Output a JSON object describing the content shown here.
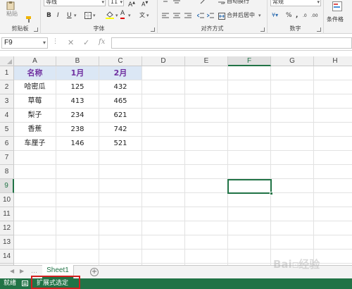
{
  "ribbon": {
    "clipboard": {
      "paste_label": "粘贴",
      "group_label": "剪贴板"
    },
    "font": {
      "font_name": "等线",
      "font_size": "11",
      "bold": "B",
      "italic": "I",
      "underline": "U",
      "font_color_glyph": "A",
      "phonetic_glyph": "文",
      "group_label": "字体"
    },
    "alignment": {
      "wrap_text": "自动换行",
      "merge_center": "合并后居中",
      "group_label": "对齐方式"
    },
    "number": {
      "format": "常规",
      "group_label": "数字"
    },
    "styles": {
      "conditional_format": "条件格"
    }
  },
  "formula_bar": {
    "name_box": "F9",
    "formula": ""
  },
  "grid": {
    "columns": [
      "A",
      "B",
      "C",
      "D",
      "E",
      "F",
      "G",
      "H"
    ],
    "selected_column": "F",
    "rows": [
      "1",
      "2",
      "3",
      "4",
      "5",
      "6",
      "7",
      "8",
      "9",
      "10",
      "11",
      "12",
      "13",
      "14"
    ],
    "selected_row": "9",
    "table": {
      "headers": [
        "名称",
        "1月",
        "2月"
      ],
      "rows": [
        [
          "哈密瓜",
          "125",
          "432"
        ],
        [
          "草莓",
          "413",
          "465"
        ],
        [
          "梨子",
          "234",
          "621"
        ],
        [
          "香蕉",
          "238",
          "742"
        ],
        [
          "车厘子",
          "146",
          "521"
        ]
      ]
    }
  },
  "sheets": {
    "tabs": [
      "Sheet1"
    ],
    "active": "Sheet1"
  },
  "status_bar": {
    "ready": "就绪",
    "mode": "扩展式选定"
  },
  "colors": {
    "accent": "#217346",
    "header_fill": "#dbe7f5",
    "header_text": "#7030a0",
    "highlight_box": "#d21f1f"
  },
  "watermark": "Bai 经验"
}
